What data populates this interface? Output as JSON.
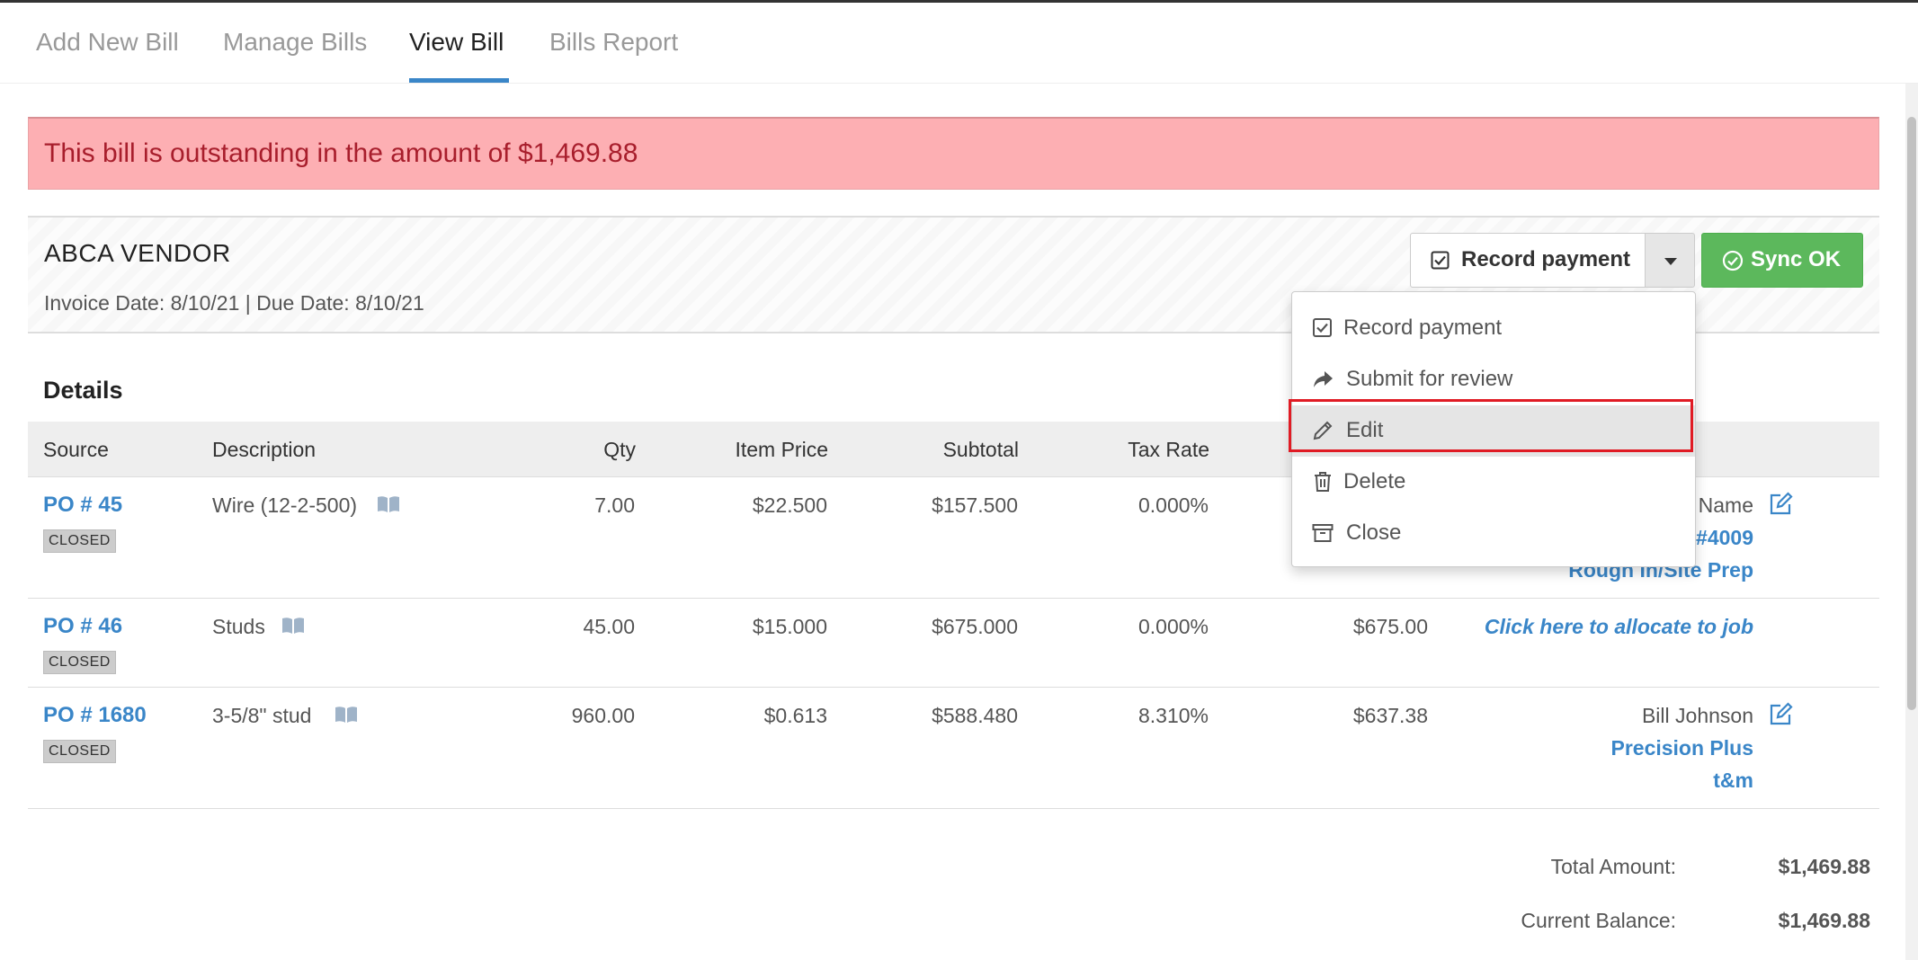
{
  "tabs": [
    {
      "label": "Add New Bill",
      "active": false
    },
    {
      "label": "Manage Bills",
      "active": false
    },
    {
      "label": "View Bill",
      "active": true
    },
    {
      "label": "Bills Report",
      "active": false
    }
  ],
  "alert": {
    "text": "This bill is outstanding in the amount of $1,469.88"
  },
  "vendor": {
    "name": "ABCA VENDOR",
    "dates": "Invoice Date: 8/10/21 | Due Date: 8/10/21"
  },
  "actions": {
    "record_payment": "Record payment",
    "sync": "Sync OK"
  },
  "dropdown": {
    "items": [
      {
        "label": "Record payment",
        "icon": "checkbox-icon"
      },
      {
        "label": "Submit for review",
        "icon": "share-icon"
      },
      {
        "label": "Edit",
        "icon": "pencil-icon"
      },
      {
        "label": "Delete",
        "icon": "trash-icon"
      },
      {
        "label": "Close",
        "icon": "archive-icon"
      }
    ]
  },
  "details": {
    "title": "Details",
    "columns": {
      "source": "Source",
      "description": "Description",
      "qty": "Qty",
      "item_price": "Item Price",
      "subtotal": "Subtotal",
      "tax_rate": "Tax Rate"
    },
    "rows": [
      {
        "po": "PO # 45",
        "status": "CLOSED",
        "description": "Wire (12-2-500)",
        "qty": "7.00",
        "item_price": "$22.500",
        "subtotal": "$157.500",
        "tax_rate": "0.000%",
        "total": "",
        "job": [
          "Name",
          "#4009",
          "Rough In/Site Prep"
        ]
      },
      {
        "po": "PO # 46",
        "status": "CLOSED",
        "description": "Studs",
        "qty": "45.00",
        "item_price": "$15.000",
        "subtotal": "$675.000",
        "tax_rate": "0.000%",
        "total": "$675.00",
        "job": [
          "Click here to allocate to job"
        ]
      },
      {
        "po": "PO # 1680",
        "status": "CLOSED",
        "description": "3-5/8\" stud",
        "qty": "960.00",
        "item_price": "$0.613",
        "subtotal": "$588.480",
        "tax_rate": "8.310%",
        "total": "$637.38",
        "job": [
          "Bill Johnson",
          "Precision Plus",
          "t&m"
        ]
      }
    ]
  },
  "totals": {
    "total_amount_label": "Total Amount:",
    "total_amount_value": "$1,469.88",
    "current_balance_label": "Current Balance:",
    "current_balance_value": "$1,469.88"
  },
  "colors": {
    "accent": "#3a86c8",
    "alert_bg": "#fdafb3",
    "alert_text": "#a81e2c",
    "success": "#5cb85c",
    "highlight_border": "#e01b24"
  }
}
